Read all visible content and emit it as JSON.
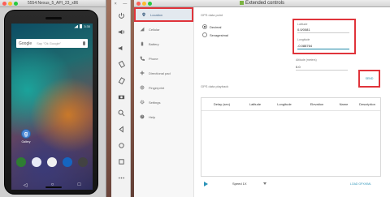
{
  "emulator": {
    "window_title": "5554:Nexus_5_API_23_x86",
    "status_time": "3:30",
    "search_logo": "Google",
    "search_hint": "Say \"Ok Google\"",
    "app_label": "Gallery",
    "app_icon_letter": "g"
  },
  "toolbar": {
    "close_glyph": "×",
    "minimize_glyph": "—",
    "buttons": [
      "power-icon",
      "volume-up-icon",
      "volume-down-icon",
      "rotate-left-icon",
      "rotate-right-icon",
      "camera-icon",
      "zoom-icon",
      "back-icon",
      "home-icon",
      "overview-icon",
      "more-icon"
    ]
  },
  "extended": {
    "title": "Extended controls",
    "nav": [
      {
        "label": "Location",
        "icon": "location-icon"
      },
      {
        "label": "Cellular",
        "icon": "cellular-icon"
      },
      {
        "label": "Battery",
        "icon": "battery-icon"
      },
      {
        "label": "Phone",
        "icon": "phone-icon"
      },
      {
        "label": "Directional pad",
        "icon": "dpad-icon"
      },
      {
        "label": "Fingerprint",
        "icon": "fingerprint-icon"
      },
      {
        "label": "Settings",
        "icon": "gear-icon"
      },
      {
        "label": "Help",
        "icon": "help-icon"
      }
    ],
    "gps_point_label": "GPS data point",
    "format_options": [
      "Decimal",
      "Sexagesimal"
    ],
    "selected_format": "Decimal",
    "latitude_label": "Latitude",
    "latitude_value": "0.0/0081",
    "longitude_label": "Longitude",
    "longitude_value": "-0.088764",
    "altitude_label": "Altitude (meters)",
    "altitude_value": "0.0",
    "send_label": "SEND",
    "playback_label": "GPS data playback",
    "columns": [
      "Delay (sec)",
      "Latitude",
      "Longitude",
      "Elevation",
      "Name",
      "Description"
    ],
    "speed_label": "Speed 1X",
    "load_label": "LOAD GPX/KML"
  },
  "colors": {
    "accent": "#2b93b8",
    "highlight_box": "#e0343b"
  }
}
